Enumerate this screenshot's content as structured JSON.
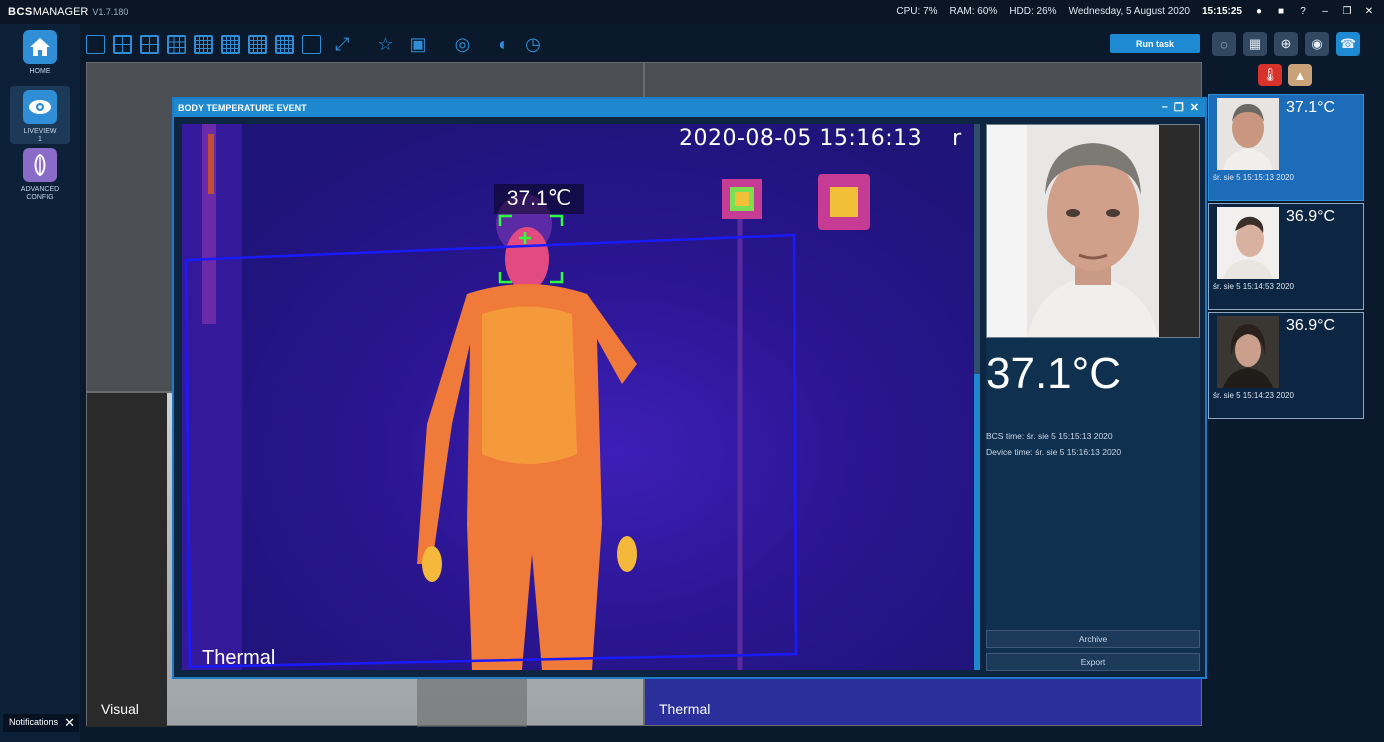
{
  "app": {
    "brand_bold": "BCS",
    "brand_rest": "MANAGER",
    "version": "V1.7.180"
  },
  "status": {
    "cpu": "CPU:  7%",
    "ram": "RAM: 60%",
    "hdd": "HDD: 26%",
    "date": "Wednesday, 5 August 2020",
    "time": "15:15:25"
  },
  "nav": [
    {
      "label": "HOME",
      "icon": "home-icon"
    },
    {
      "label": "LIVEVIEW\n1",
      "icon": "eye-icon"
    },
    {
      "label": "ADVANCED\nCONFIG",
      "icon": "config-icon"
    }
  ],
  "toolbar": {
    "run_task": "Run task"
  },
  "views": {
    "visual_label": "Visual",
    "thermal_label": "Thermal"
  },
  "dialog": {
    "title": "BODY TEMPERATURE EVENT",
    "timestamp": "2020-08-05 15:16:13",
    "timestamp_suffix": "r",
    "head_temp": "37.1℃",
    "thermal_label": "Thermal",
    "big_temp": "37.1°C",
    "bcs_time": "BCS time: śr. sie 5 15:15:13 2020",
    "device_time": "Device time: śr. sie 5 15:16:13 2020",
    "archive": "Archive",
    "export": "Export"
  },
  "events": [
    {
      "temp": "37.1°C",
      "time": "śr. sie 5 15:15:13 2020",
      "selected": true
    },
    {
      "temp": "36.9°C",
      "time": "śr. sie 5 15:14:53 2020",
      "selected": false
    },
    {
      "temp": "36.9°C",
      "time": "śr. sie 5 15:14:23 2020",
      "selected": false
    }
  ],
  "notifications": {
    "label": "Notifications"
  }
}
